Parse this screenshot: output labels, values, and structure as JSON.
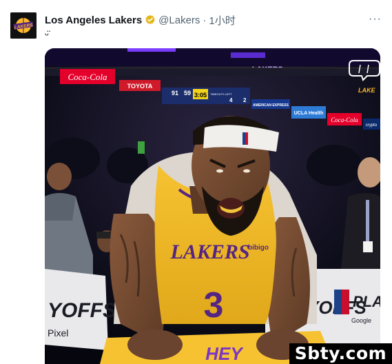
{
  "author": {
    "display_name": "Los Angeles Lakers",
    "handle": "@Lakers",
    "separator": "·",
    "time": "1小时",
    "avatar_text": "LAKERS"
  },
  "tweet": {
    "text": "ᵕ̈"
  },
  "menu": {
    "more_label": "···"
  },
  "media": {
    "board_ads": [
      "Coca-Cola",
      "TOYOTA",
      "AMERICAN EXPRESS",
      "UCLA Health",
      "Coca-Cola",
      "crypto"
    ],
    "scoreboard": {
      "home_score": "91",
      "away_score": "59",
      "clock": "3:05",
      "timeouts_label": "TIMEOUTS LEFT",
      "quarter": "4",
      "timeouts": "2"
    },
    "arena_text": "LAKERS",
    "jersey_text": "LAKERS",
    "jersey_number": "3",
    "jersey_sponsor": "bibigo",
    "banner_left": "YOFFS",
    "banner_left_sub": "Pixel",
    "banner_right": "PLAYOFFS",
    "banner_right_sub": "Google",
    "banner_right2": "PLAY"
  },
  "watermark": {
    "text": "Sbty.com"
  },
  "colors": {
    "lakers_purple": "#552583",
    "lakers_gold": "#fdb927",
    "verified_gold": "#e2b719",
    "coca_red": "#e4002b"
  }
}
